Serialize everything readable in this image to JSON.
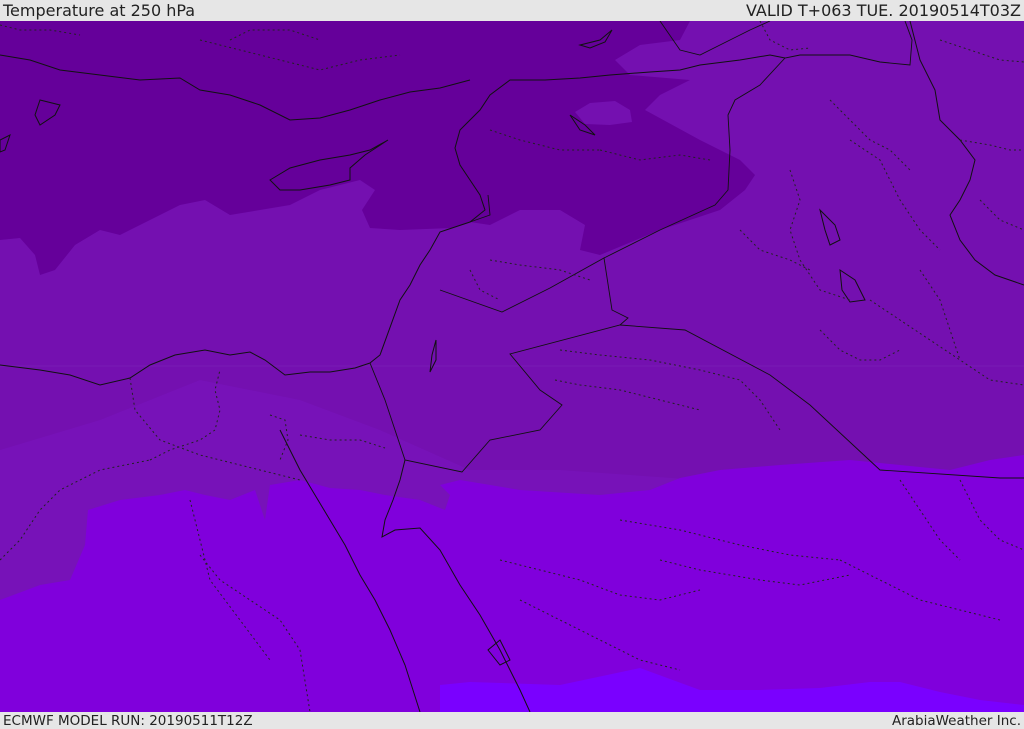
{
  "header": {
    "title": "Temperature at 250 hPa",
    "valid_time": "VALID T+063 TUE. 20190514T03Z"
  },
  "footer": {
    "model_run": "ECMWF MODEL RUN: 20190511T12Z",
    "credit": "ArabiaWeather Inc."
  },
  "colors": {
    "band_coldest": "#65009a",
    "band_cold": "#7410b0",
    "band_mid": "#7a0fc0",
    "band_warm": "#8000dc",
    "band_warmest": "#7a00ff",
    "page_bg": "#e6e6e6"
  }
}
